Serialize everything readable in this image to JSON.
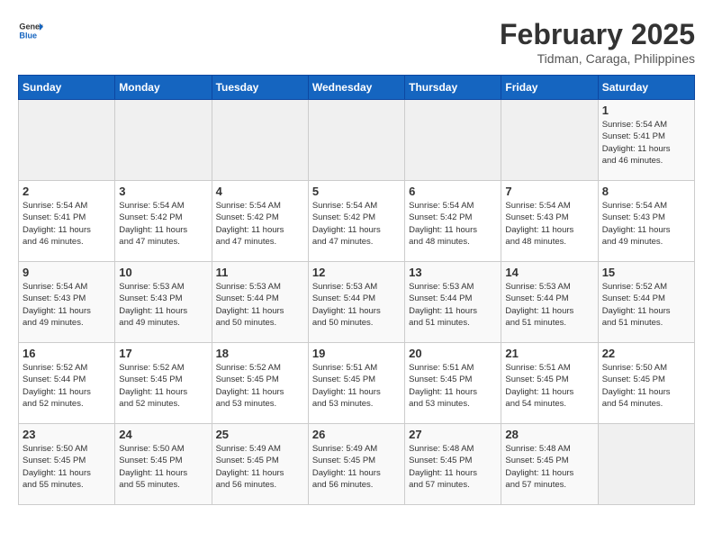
{
  "header": {
    "logo_general": "General",
    "logo_blue": "Blue",
    "month_title": "February 2025",
    "subtitle": "Tidman, Caraga, Philippines"
  },
  "weekdays": [
    "Sunday",
    "Monday",
    "Tuesday",
    "Wednesday",
    "Thursday",
    "Friday",
    "Saturday"
  ],
  "weeks": [
    [
      {
        "day": "",
        "info": ""
      },
      {
        "day": "",
        "info": ""
      },
      {
        "day": "",
        "info": ""
      },
      {
        "day": "",
        "info": ""
      },
      {
        "day": "",
        "info": ""
      },
      {
        "day": "",
        "info": ""
      },
      {
        "day": "1",
        "info": "Sunrise: 5:54 AM\nSunset: 5:41 PM\nDaylight: 11 hours\nand 46 minutes."
      }
    ],
    [
      {
        "day": "2",
        "info": "Sunrise: 5:54 AM\nSunset: 5:41 PM\nDaylight: 11 hours\nand 46 minutes."
      },
      {
        "day": "3",
        "info": "Sunrise: 5:54 AM\nSunset: 5:42 PM\nDaylight: 11 hours\nand 47 minutes."
      },
      {
        "day": "4",
        "info": "Sunrise: 5:54 AM\nSunset: 5:42 PM\nDaylight: 11 hours\nand 47 minutes."
      },
      {
        "day": "5",
        "info": "Sunrise: 5:54 AM\nSunset: 5:42 PM\nDaylight: 11 hours\nand 47 minutes."
      },
      {
        "day": "6",
        "info": "Sunrise: 5:54 AM\nSunset: 5:42 PM\nDaylight: 11 hours\nand 48 minutes."
      },
      {
        "day": "7",
        "info": "Sunrise: 5:54 AM\nSunset: 5:43 PM\nDaylight: 11 hours\nand 48 minutes."
      },
      {
        "day": "8",
        "info": "Sunrise: 5:54 AM\nSunset: 5:43 PM\nDaylight: 11 hours\nand 49 minutes."
      }
    ],
    [
      {
        "day": "9",
        "info": "Sunrise: 5:54 AM\nSunset: 5:43 PM\nDaylight: 11 hours\nand 49 minutes."
      },
      {
        "day": "10",
        "info": "Sunrise: 5:53 AM\nSunset: 5:43 PM\nDaylight: 11 hours\nand 49 minutes."
      },
      {
        "day": "11",
        "info": "Sunrise: 5:53 AM\nSunset: 5:44 PM\nDaylight: 11 hours\nand 50 minutes."
      },
      {
        "day": "12",
        "info": "Sunrise: 5:53 AM\nSunset: 5:44 PM\nDaylight: 11 hours\nand 50 minutes."
      },
      {
        "day": "13",
        "info": "Sunrise: 5:53 AM\nSunset: 5:44 PM\nDaylight: 11 hours\nand 51 minutes."
      },
      {
        "day": "14",
        "info": "Sunrise: 5:53 AM\nSunset: 5:44 PM\nDaylight: 11 hours\nand 51 minutes."
      },
      {
        "day": "15",
        "info": "Sunrise: 5:52 AM\nSunset: 5:44 PM\nDaylight: 11 hours\nand 51 minutes."
      }
    ],
    [
      {
        "day": "16",
        "info": "Sunrise: 5:52 AM\nSunset: 5:44 PM\nDaylight: 11 hours\nand 52 minutes."
      },
      {
        "day": "17",
        "info": "Sunrise: 5:52 AM\nSunset: 5:45 PM\nDaylight: 11 hours\nand 52 minutes."
      },
      {
        "day": "18",
        "info": "Sunrise: 5:52 AM\nSunset: 5:45 PM\nDaylight: 11 hours\nand 53 minutes."
      },
      {
        "day": "19",
        "info": "Sunrise: 5:51 AM\nSunset: 5:45 PM\nDaylight: 11 hours\nand 53 minutes."
      },
      {
        "day": "20",
        "info": "Sunrise: 5:51 AM\nSunset: 5:45 PM\nDaylight: 11 hours\nand 53 minutes."
      },
      {
        "day": "21",
        "info": "Sunrise: 5:51 AM\nSunset: 5:45 PM\nDaylight: 11 hours\nand 54 minutes."
      },
      {
        "day": "22",
        "info": "Sunrise: 5:50 AM\nSunset: 5:45 PM\nDaylight: 11 hours\nand 54 minutes."
      }
    ],
    [
      {
        "day": "23",
        "info": "Sunrise: 5:50 AM\nSunset: 5:45 PM\nDaylight: 11 hours\nand 55 minutes."
      },
      {
        "day": "24",
        "info": "Sunrise: 5:50 AM\nSunset: 5:45 PM\nDaylight: 11 hours\nand 55 minutes."
      },
      {
        "day": "25",
        "info": "Sunrise: 5:49 AM\nSunset: 5:45 PM\nDaylight: 11 hours\nand 56 minutes."
      },
      {
        "day": "26",
        "info": "Sunrise: 5:49 AM\nSunset: 5:45 PM\nDaylight: 11 hours\nand 56 minutes."
      },
      {
        "day": "27",
        "info": "Sunrise: 5:48 AM\nSunset: 5:45 PM\nDaylight: 11 hours\nand 57 minutes."
      },
      {
        "day": "28",
        "info": "Sunrise: 5:48 AM\nSunset: 5:45 PM\nDaylight: 11 hours\nand 57 minutes."
      },
      {
        "day": "",
        "info": ""
      }
    ]
  ]
}
